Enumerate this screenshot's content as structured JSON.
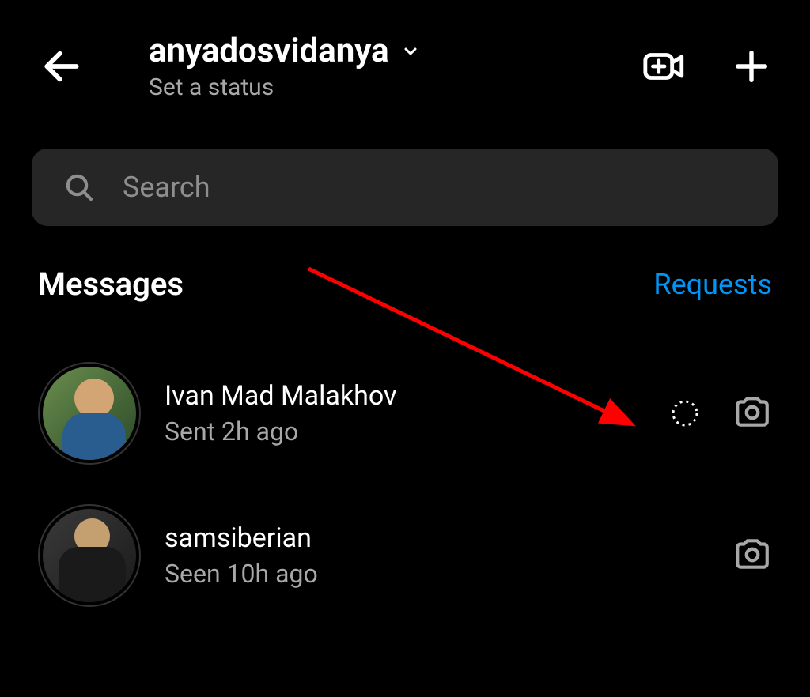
{
  "header": {
    "username": "anyadosvidanya",
    "status_prompt": "Set a status"
  },
  "search": {
    "placeholder": "Search"
  },
  "tabs": {
    "messages_label": "Messages",
    "requests_label": "Requests"
  },
  "threads": [
    {
      "name": "Ivan Mad Malakhov",
      "status": "Sent 2h ago",
      "has_vanish_indicator": true
    },
    {
      "name": "samsiberian",
      "status": "Seen 10h ago",
      "has_vanish_indicator": false
    }
  ],
  "colors": {
    "accent": "#0095f6",
    "background": "#000000",
    "surface": "#262626",
    "text_secondary": "#a8a8a8",
    "annotation": "#ff0000"
  }
}
